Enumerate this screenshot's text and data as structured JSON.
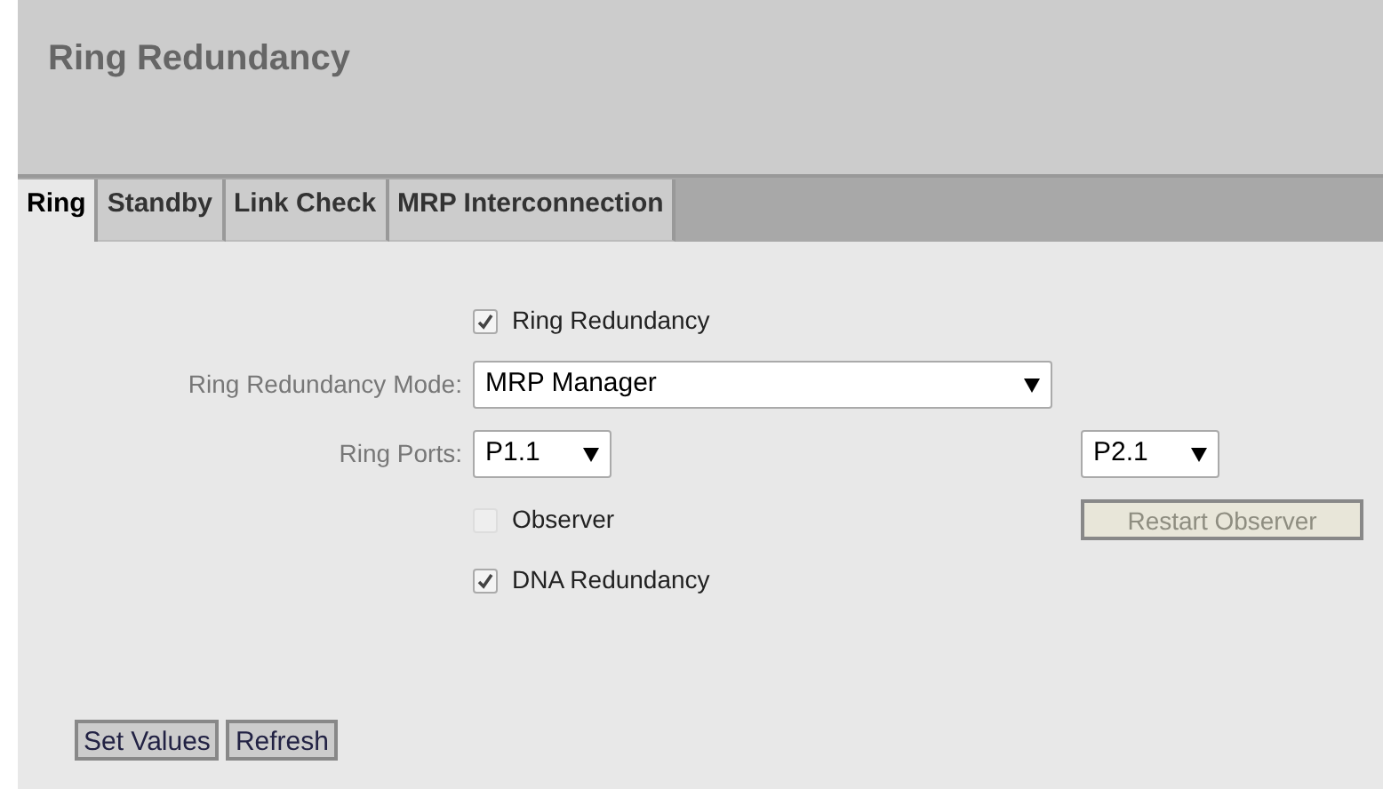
{
  "page": {
    "title": "Ring Redundancy"
  },
  "tabs": [
    {
      "label": "Ring",
      "selected": true
    },
    {
      "label": "Standby",
      "selected": false
    },
    {
      "label": "Link Check",
      "selected": false
    },
    {
      "label": "MRP Interconnection",
      "selected": false
    }
  ],
  "ring_redundancy": {
    "label": "Ring Redundancy",
    "checked": true,
    "disabled": false
  },
  "mode": {
    "label": "Ring Redundancy Mode:",
    "value": "MRP Manager"
  },
  "ring_ports": {
    "label": "Ring Ports:",
    "port_1": "P1.1",
    "port_2": "P2.1"
  },
  "observer": {
    "label": "Observer",
    "checked": false,
    "disabled": true
  },
  "restart_observer": {
    "label": "Restart Observer",
    "disabled": true
  },
  "dna_redundancy": {
    "label": "DNA Redundancy",
    "checked": true,
    "disabled": false
  },
  "buttons": [
    "Set Values",
    "Refresh"
  ]
}
